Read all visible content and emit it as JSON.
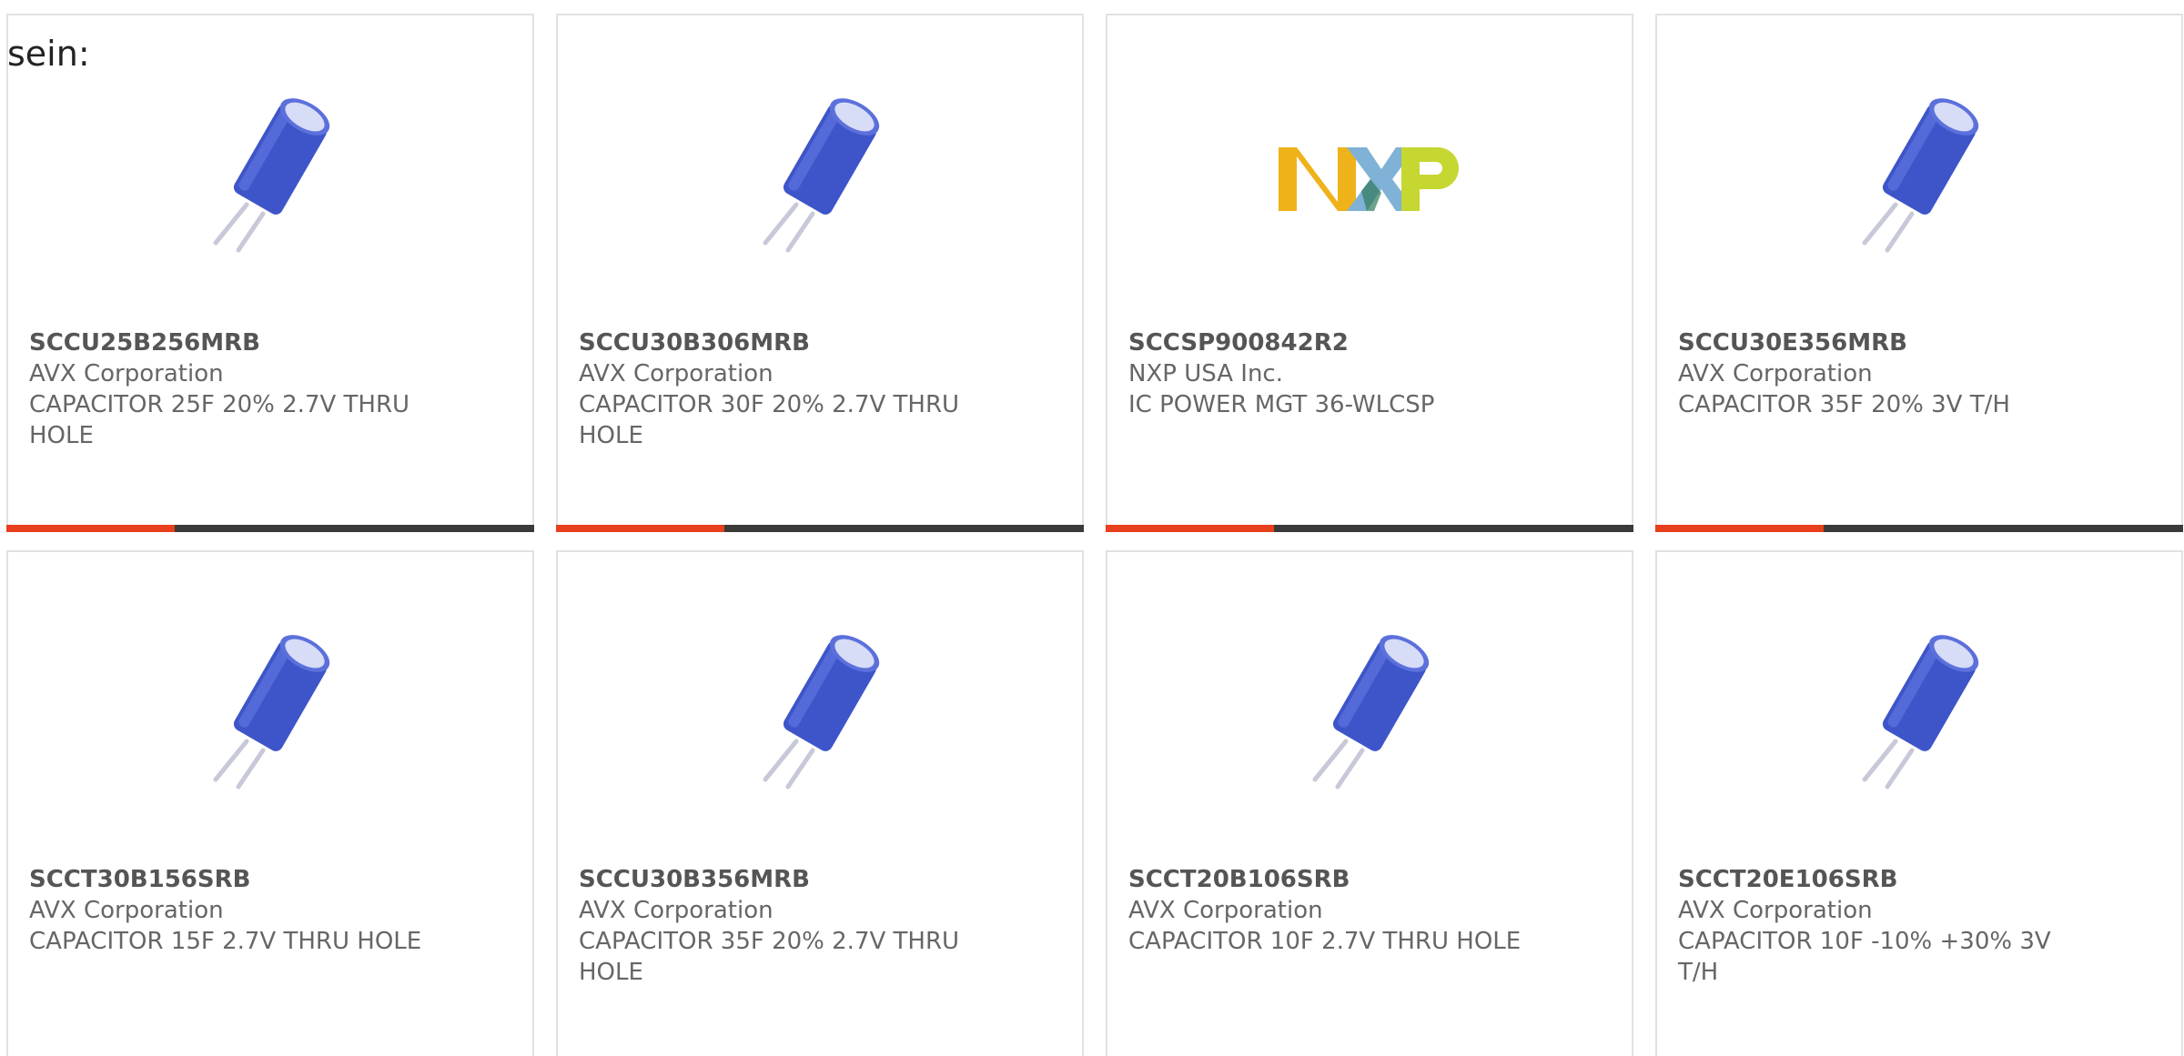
{
  "intro_text": "sein:",
  "colors": {
    "accent": "#e8401c",
    "bar": "#3a3a3a",
    "capacitor_blue": "#3e55c9"
  },
  "products": [
    {
      "part": "SCCU25B256MRB",
      "maker": "AVX Corporation",
      "desc": "CAPACITOR 25F 20% 2.7V THRU HOLE",
      "image": "capacitor-icon"
    },
    {
      "part": "SCCU30B306MRB",
      "maker": "AVX Corporation",
      "desc": "CAPACITOR 30F 20% 2.7V THRU HOLE",
      "image": "capacitor-icon"
    },
    {
      "part": "SCCSP900842R2",
      "maker": "NXP USA Inc.",
      "desc": "IC POWER MGT 36-WLCSP",
      "image": "nxp-logo",
      "logo_text": "NXP"
    },
    {
      "part": "SCCU30E356MRB",
      "maker": "AVX Corporation",
      "desc": "CAPACITOR 35F 20% 3V T/H",
      "image": "capacitor-icon"
    },
    {
      "part": "SCCT30B156SRB",
      "maker": "AVX Corporation",
      "desc": "CAPACITOR 15F 2.7V THRU HOLE",
      "image": "capacitor-icon"
    },
    {
      "part": "SCCU30B356MRB",
      "maker": "AVX Corporation",
      "desc": "CAPACITOR 35F 20% 2.7V THRU HOLE",
      "image": "capacitor-icon"
    },
    {
      "part": "SCCT20B106SRB",
      "maker": "AVX Corporation",
      "desc": "CAPACITOR 10F 2.7V THRU HOLE",
      "image": "capacitor-icon"
    },
    {
      "part": "SCCT20E106SRB",
      "maker": "AVX Corporation",
      "desc": "CAPACITOR 10F -10% +30% 3V T/H",
      "image": "capacitor-icon"
    }
  ]
}
